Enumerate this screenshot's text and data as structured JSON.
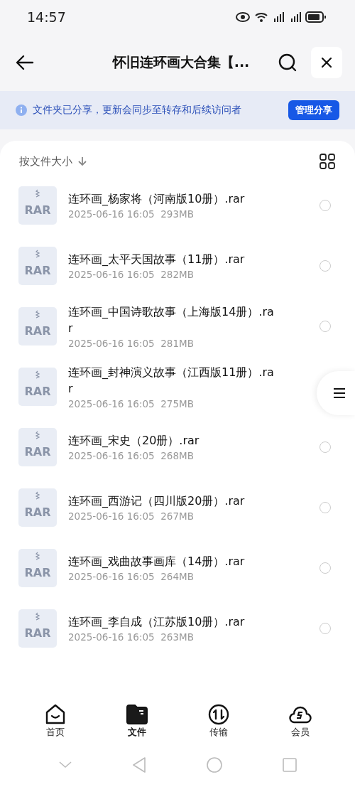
{
  "status_bar": {
    "time": "14:57"
  },
  "header": {
    "title": "怀旧连环画大合集【..."
  },
  "share_banner": {
    "text": "文件夹已分享，更新会同步至转存和后续访问者",
    "button": "管理分享"
  },
  "sort": {
    "label": "按文件大小"
  },
  "files": [
    {
      "type_label": "RAR",
      "name": "连环画_杨家将（河南版10册）.rar",
      "date": "2025-06-16 16:05",
      "size": "293MB",
      "selected": false
    },
    {
      "type_label": "RAR",
      "name": "连环画_太平天国故事（11册）.rar",
      "date": "2025-06-16 16:05",
      "size": "282MB",
      "selected": false
    },
    {
      "type_label": "RAR",
      "name": "连环画_中国诗歌故事（上海版14册）.rar",
      "date": "2025-06-16 16:05",
      "size": "281MB",
      "selected": false
    },
    {
      "type_label": "RAR",
      "name": "连环画_封神演义故事（江西版11册）.rar",
      "date": "2025-06-16 16:05",
      "size": "275MB"
    },
    {
      "type_label": "RAR",
      "name": "连环画_宋史（20册）.rar",
      "date": "2025-06-16 16:05",
      "size": "268MB",
      "selected": false
    },
    {
      "type_label": "RAR",
      "name": "连环画_西游记（四川版20册）.rar",
      "date": "2025-06-16 16:05",
      "size": "267MB",
      "selected": false
    },
    {
      "type_label": "RAR",
      "name": "连环画_戏曲故事画库（14册）.rar",
      "date": "2025-06-16 16:05",
      "size": "264MB",
      "selected": false
    },
    {
      "type_label": "RAR",
      "name": "连环画_李自成（江苏版10册）.rar",
      "date": "2025-06-16 16:05",
      "size": "263MB",
      "selected": false
    }
  ],
  "tabs": [
    {
      "kind": "home",
      "label": "首页",
      "selected": false
    },
    {
      "kind": "files",
      "label": "文件",
      "selected": true
    },
    {
      "kind": "transfer",
      "label": "传输",
      "selected": false
    },
    {
      "kind": "vip",
      "label": "会员",
      "selected": false
    }
  ]
}
